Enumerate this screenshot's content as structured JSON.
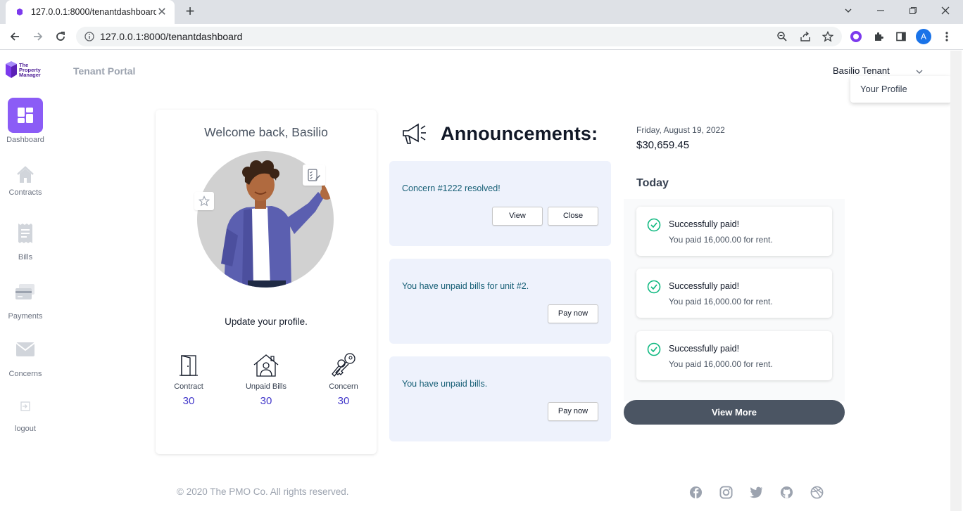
{
  "browser": {
    "tab_title": "127.0.0.1:8000/tenantdashboard",
    "url": "127.0.0.1:8000/tenantdashboard",
    "profile_initial": "A"
  },
  "app": {
    "logo_text": [
      "The",
      "Property",
      "Manager"
    ],
    "portal_title": "Tenant Portal",
    "user_name": "Basilio Tenant",
    "dropdown_item": "Your Profile"
  },
  "sidebar": {
    "items": [
      {
        "label": "Dashboard",
        "icon": "dashboard-icon",
        "active": true
      },
      {
        "label": "Contracts",
        "icon": "home-icon"
      },
      {
        "label": "Bills",
        "icon": "receipt-icon"
      },
      {
        "label": "Payments",
        "icon": "card-icon"
      },
      {
        "label": "Concerns",
        "icon": "mail-icon"
      },
      {
        "label": "logout",
        "icon": "logout-icon"
      }
    ]
  },
  "profile": {
    "welcome": "Welcome back, Basilio",
    "update_prompt": "Update your profile.",
    "stats": [
      {
        "label": "Contract",
        "value": "30",
        "icon": "door-icon"
      },
      {
        "label": "Unpaid Bills",
        "value": "30",
        "icon": "house-person-icon"
      },
      {
        "label": "Concern",
        "value": "30",
        "icon": "keys-icon"
      }
    ]
  },
  "announcements": {
    "title": "Announcements:",
    "items": [
      {
        "message": "Concern #1222 resolved!",
        "buttons": [
          "View",
          "Close"
        ]
      },
      {
        "message": "You have unpaid bills for unit #2.",
        "buttons": [
          "Pay now"
        ]
      },
      {
        "message": "You have unpaid bills.",
        "buttons": [
          "Pay now"
        ]
      }
    ]
  },
  "summary": {
    "date": "Friday, August 19, 2022",
    "amount": "$30,659.45",
    "today_label": "Today",
    "notifications": [
      {
        "title": "Successfully paid!",
        "body": "You paid 16,000.00 for rent."
      },
      {
        "title": "Successfully paid!",
        "body": "You paid 16,000.00 for rent."
      },
      {
        "title": "Successfully paid!",
        "body": "You paid 16,000.00 for rent."
      }
    ],
    "view_more": "View More"
  },
  "footer": {
    "copyright": "© 2020 The PMO Co. All rights reserved.",
    "social_icons": [
      "facebook-icon",
      "instagram-icon",
      "twitter-icon",
      "github-icon",
      "dribbble-icon"
    ]
  },
  "colors": {
    "accent": "#8b5cf6",
    "announcement_bg": "#eef2fc",
    "success": "#10b981",
    "button_dark": "#4b5563"
  }
}
